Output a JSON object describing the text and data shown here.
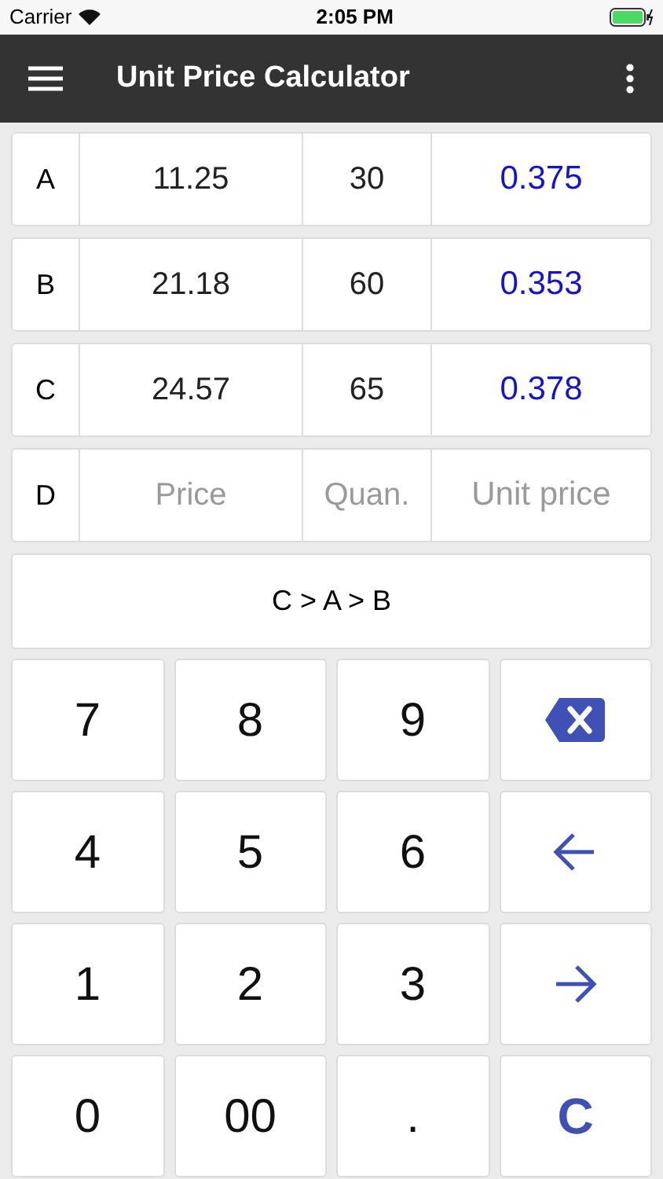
{
  "status_bar": {
    "carrier": "Carrier",
    "time": "2:05 PM"
  },
  "app_bar": {
    "title": "Unit Price Calculator"
  },
  "items": [
    {
      "label": "A",
      "price": {
        "value": "11.25"
      },
      "quantity": {
        "value": "30"
      },
      "unit_price": {
        "value": "0.375"
      }
    },
    {
      "label": "B",
      "price": {
        "value": "21.18"
      },
      "quantity": {
        "value": "60"
      },
      "unit_price": {
        "value": "0.353"
      }
    },
    {
      "label": "C",
      "price": {
        "value": "24.57"
      },
      "quantity": {
        "value": "65"
      },
      "unit_price": {
        "value": "0.378"
      }
    },
    {
      "label": "D",
      "price": {
        "placeholder": "Price"
      },
      "quantity": {
        "placeholder": "Quan."
      },
      "unit_price": {
        "placeholder": "Unit price"
      }
    }
  ],
  "ranking": "C > A > B",
  "keys": [
    {
      "kind": "digit",
      "label": "7"
    },
    {
      "kind": "digit",
      "label": "8"
    },
    {
      "kind": "digit",
      "label": "9"
    },
    {
      "kind": "delete"
    },
    {
      "kind": "digit",
      "label": "4"
    },
    {
      "kind": "digit",
      "label": "5"
    },
    {
      "kind": "digit",
      "label": "6"
    },
    {
      "kind": "left"
    },
    {
      "kind": "digit",
      "label": "1"
    },
    {
      "kind": "digit",
      "label": "2"
    },
    {
      "kind": "digit",
      "label": "3"
    },
    {
      "kind": "right"
    },
    {
      "kind": "digit",
      "label": "0"
    },
    {
      "kind": "digit",
      "label": "00"
    },
    {
      "kind": "digit",
      "label": "."
    },
    {
      "kind": "clear",
      "label": "C"
    }
  ]
}
